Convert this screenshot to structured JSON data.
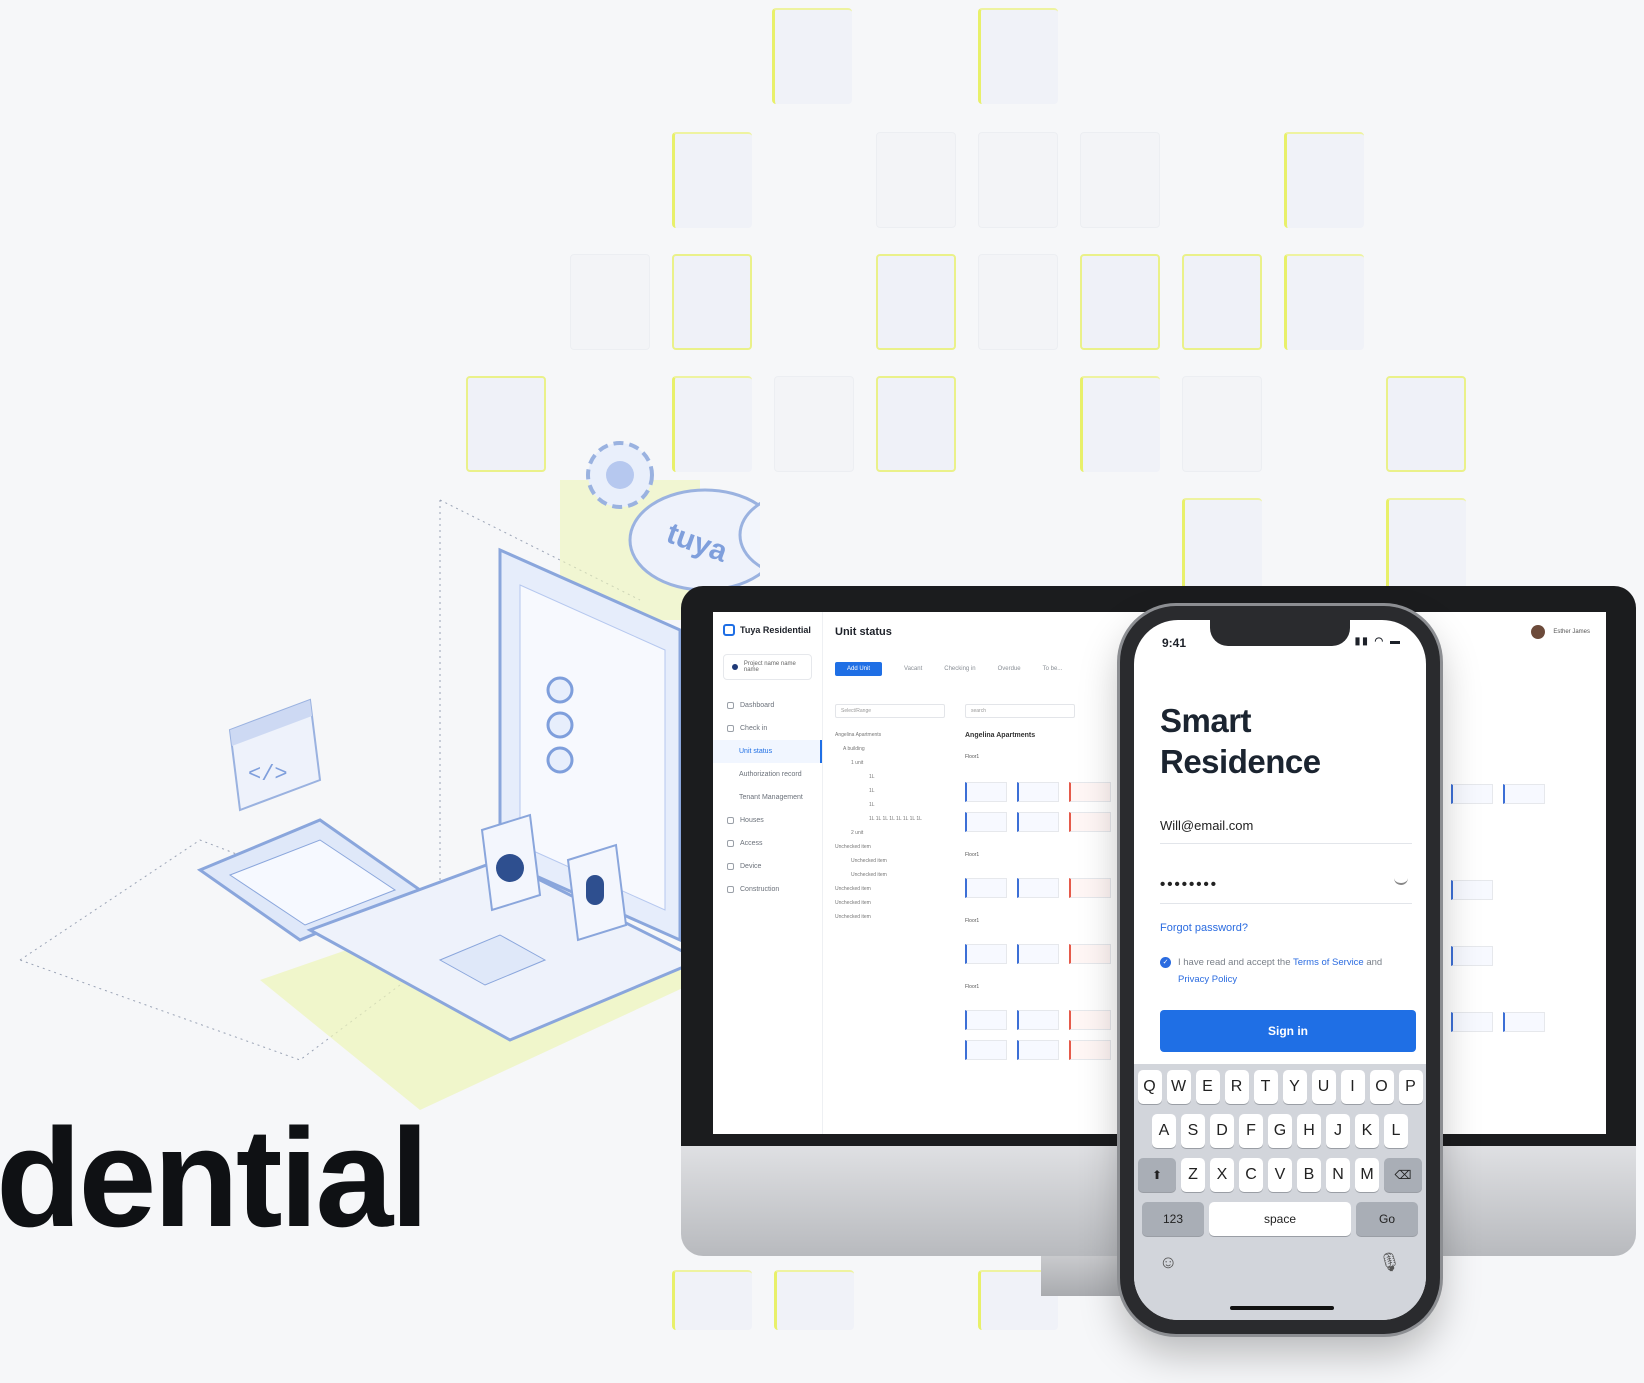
{
  "headline": "dential",
  "illustration": {
    "cloud_brand": "tuya",
    "code_symbol": "</>"
  },
  "desktop_app": {
    "brand": "Tuya Residential",
    "page_title": "Unit status",
    "project": "Project name name name",
    "user": "Esther James",
    "nav": [
      "Dashboard",
      "Check in",
      "Unit status",
      "Authorization record",
      "Tenant Management",
      "Houses",
      "Access",
      "Device",
      "Construction"
    ],
    "toolbar": {
      "add": "Add Unit",
      "tabs": [
        "Vacant",
        "Checking in",
        "Overdue",
        "To be..."
      ]
    },
    "filter_placeholder": "Select/Range",
    "search_placeholder": "search",
    "tree": [
      "Angelina Apartments",
      "A building",
      "1 unit",
      "1L",
      "1L",
      "1L",
      "1L 1L 1L 1L 1L 1L 1L 1L",
      "2 unit",
      "Unchecked item",
      "Unchecked item",
      "Unchecked item",
      "Unchecked item",
      "Unchecked item",
      "Unchecked item"
    ],
    "section_title": "Angelina Apartments",
    "floors": [
      "Floor1",
      "Floor1",
      "Floor1",
      "Floor1"
    ]
  },
  "phone": {
    "time": "9:41",
    "title_line1": "Smart",
    "title_line2": "Residence",
    "email": "Will@email.com",
    "password_mask": "••••••••",
    "forgot": "Forgot password?",
    "agree_prefix": "I have read and accept the ",
    "terms": "Terms of Service",
    "agree_and": " and ",
    "privacy": "Privacy Policy",
    "sign_in": "Sign in",
    "keyboard": {
      "row1": [
        "Q",
        "W",
        "E",
        "R",
        "T",
        "Y",
        "U",
        "I",
        "O",
        "P"
      ],
      "row2": [
        "A",
        "S",
        "D",
        "F",
        "G",
        "H",
        "J",
        "K",
        "L"
      ],
      "row3": [
        "Z",
        "X",
        "C",
        "V",
        "B",
        "N",
        "M"
      ],
      "numbers": "123",
      "space": "space",
      "go": "Go"
    }
  },
  "colors": {
    "accent": "#1f6fe5",
    "tile_highlight": "#e8f06a"
  }
}
